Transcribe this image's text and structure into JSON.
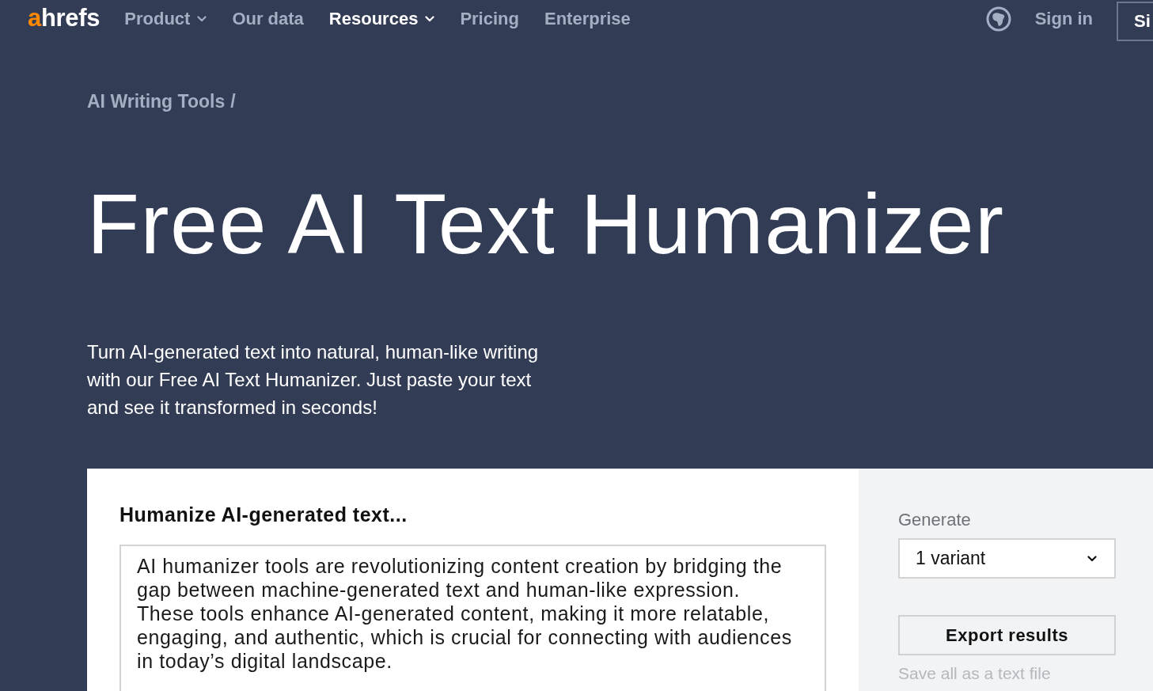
{
  "header": {
    "logo": {
      "accent": "a",
      "rest": "hrefs"
    },
    "nav": [
      {
        "label": "Product",
        "dropdown": true,
        "selected": false
      },
      {
        "label": "Our data",
        "dropdown": false,
        "selected": false
      },
      {
        "label": "Resources",
        "dropdown": true,
        "selected": true
      },
      {
        "label": "Pricing",
        "dropdown": false,
        "selected": false
      },
      {
        "label": "Enterprise",
        "dropdown": false,
        "selected": false
      }
    ],
    "sign_in": "Sign in",
    "sign_up": "Si"
  },
  "breadcrumb": {
    "items": [
      "AI Writing Tools"
    ],
    "separator": "/"
  },
  "title": "Free AI Text Humanizer",
  "intro": "Turn AI-generated text into natural, human-like writing with our Free AI Text Humanizer. Just paste your text and see it transformed in seconds!",
  "tool": {
    "heading": "Humanize AI-generated text...",
    "input": {
      "value": "AI humanizer tools are revolutionizing content creation by bridging the gap between machine-generated text and human-like expression. These tools enhance AI-generated content, making it more relatable, engaging, and authentic, which is crucial for connecting with audiences in today’s digital landscape."
    },
    "generate": {
      "label": "Generate",
      "value": "1 variant"
    },
    "export": {
      "label": "Export results",
      "note": "Save all as a text file"
    }
  }
}
